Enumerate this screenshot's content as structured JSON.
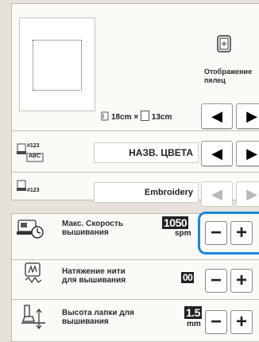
{
  "preview": {
    "frame_caption": "Отображение пялец",
    "width_label": "18cm",
    "times": "×",
    "height_label": "13cm"
  },
  "color_row": {
    "icon_top": "#123",
    "icon_bottom": "ABC",
    "value": "НАЗВ. ЦВЕТА"
  },
  "brand_row": {
    "icon_top": "#123",
    "value": "Embroidery"
  },
  "speed_row": {
    "label_line1": "Макс. Скорость",
    "label_line2": "вышивания",
    "value": "1050",
    "unit": "spm"
  },
  "tension_row": {
    "label_line1": "Натяжение нити",
    "label_line2": "для вышивания",
    "value": "00"
  },
  "foot_row": {
    "label_line1": "Высота лапки для",
    "label_line2": "вышивания",
    "value": "1.5",
    "unit": "mm"
  },
  "buttons": {
    "left": "◀",
    "right": "▶",
    "minus": "−",
    "plus": "+"
  },
  "colors": {
    "highlight": "#1a86d6",
    "background": "#e6e2da",
    "panel": "#fbfaf7"
  }
}
